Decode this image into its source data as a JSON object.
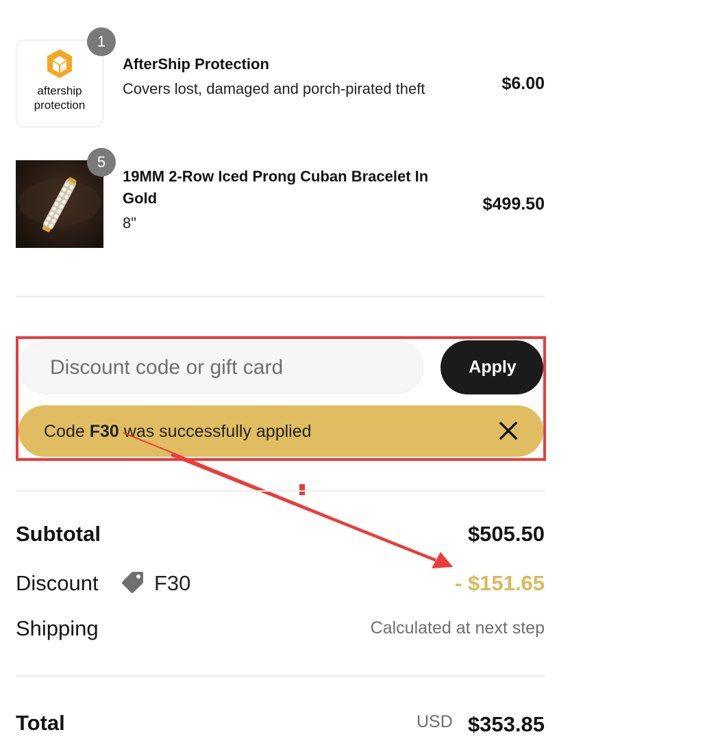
{
  "line_items": [
    {
      "name": "AfterShip Protection",
      "subtitle": "Covers lost, damaged and porch-pirated theft",
      "quantity": "1",
      "price": "$6.00",
      "logo_text_line1": "aftership",
      "logo_text_line2": "protection"
    },
    {
      "name": "19MM 2-Row Iced Prong Cuban Bracelet In Gold",
      "subtitle": "8\"",
      "quantity": "5",
      "price": "$499.50"
    }
  ],
  "discount": {
    "placeholder": "Discount code or gift card",
    "apply_label": "Apply",
    "applied_prefix": "Code",
    "applied_code": "F30",
    "applied_suffix": "was successfully applied"
  },
  "summary": {
    "subtotal_label": "Subtotal",
    "subtotal_value": "$505.50",
    "discount_label": "Discount",
    "discount_code": "F30",
    "discount_value": "- $151.65",
    "shipping_label": "Shipping",
    "shipping_value": "Calculated at next step",
    "total_label": "Total",
    "currency": "USD",
    "total_value": "$353.85"
  },
  "colors": {
    "accent_gold": "#dfbd60",
    "discount_text": "#d9b95c",
    "apply_bg": "#1b1b1b",
    "annotation_red": "#ec3b3b",
    "aftership_orange": "#f5a623"
  },
  "icons": [
    "aftership-logo-icon",
    "close-icon",
    "price-tag-icon"
  ]
}
